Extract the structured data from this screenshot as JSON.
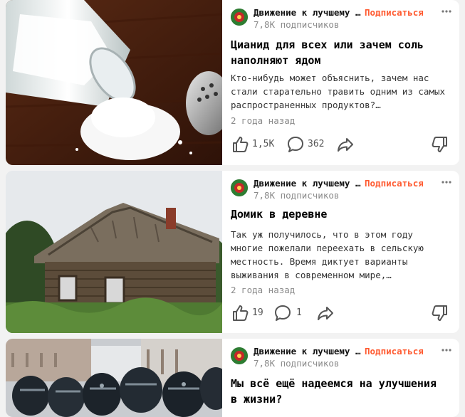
{
  "subscribe_label": "Подписаться",
  "accent_color": "#ff5a30",
  "icons": {
    "like": "thumb-up-icon",
    "comment": "comment-bubble-icon",
    "share": "share-arrow-icon",
    "dislike": "thumb-down-icon",
    "more": "more-dots-icon"
  },
  "articles": [
    {
      "channel": "Движение к лучшему мира",
      "subscribers": "7,8K подписчиков",
      "title": "Цианид для всех или зачем соль наполняют ядом",
      "snippet": "Кто-нибудь может объяснить, зачем нас стали старательно травить одним из самых распространенных продуктов?…",
      "date": "2 года назад",
      "likes": "1,5K",
      "comments": "362"
    },
    {
      "channel": "Движение к лучшему мира",
      "subscribers": "7,8K подписчиков",
      "title": "Домик в деревне",
      "snippet": "Так уж получилось, что в этом году многие пожелали переехать в сельскую местность. Время диктует варианты выживания в современном мире,…",
      "date": "2 года назад",
      "likes": "19",
      "comments": "1"
    },
    {
      "channel": "Движение к лучшему мира",
      "subscribers": "7,8K подписчиков",
      "title": "Мы всё ещё надеемся на улучшения в жизни?"
    }
  ]
}
